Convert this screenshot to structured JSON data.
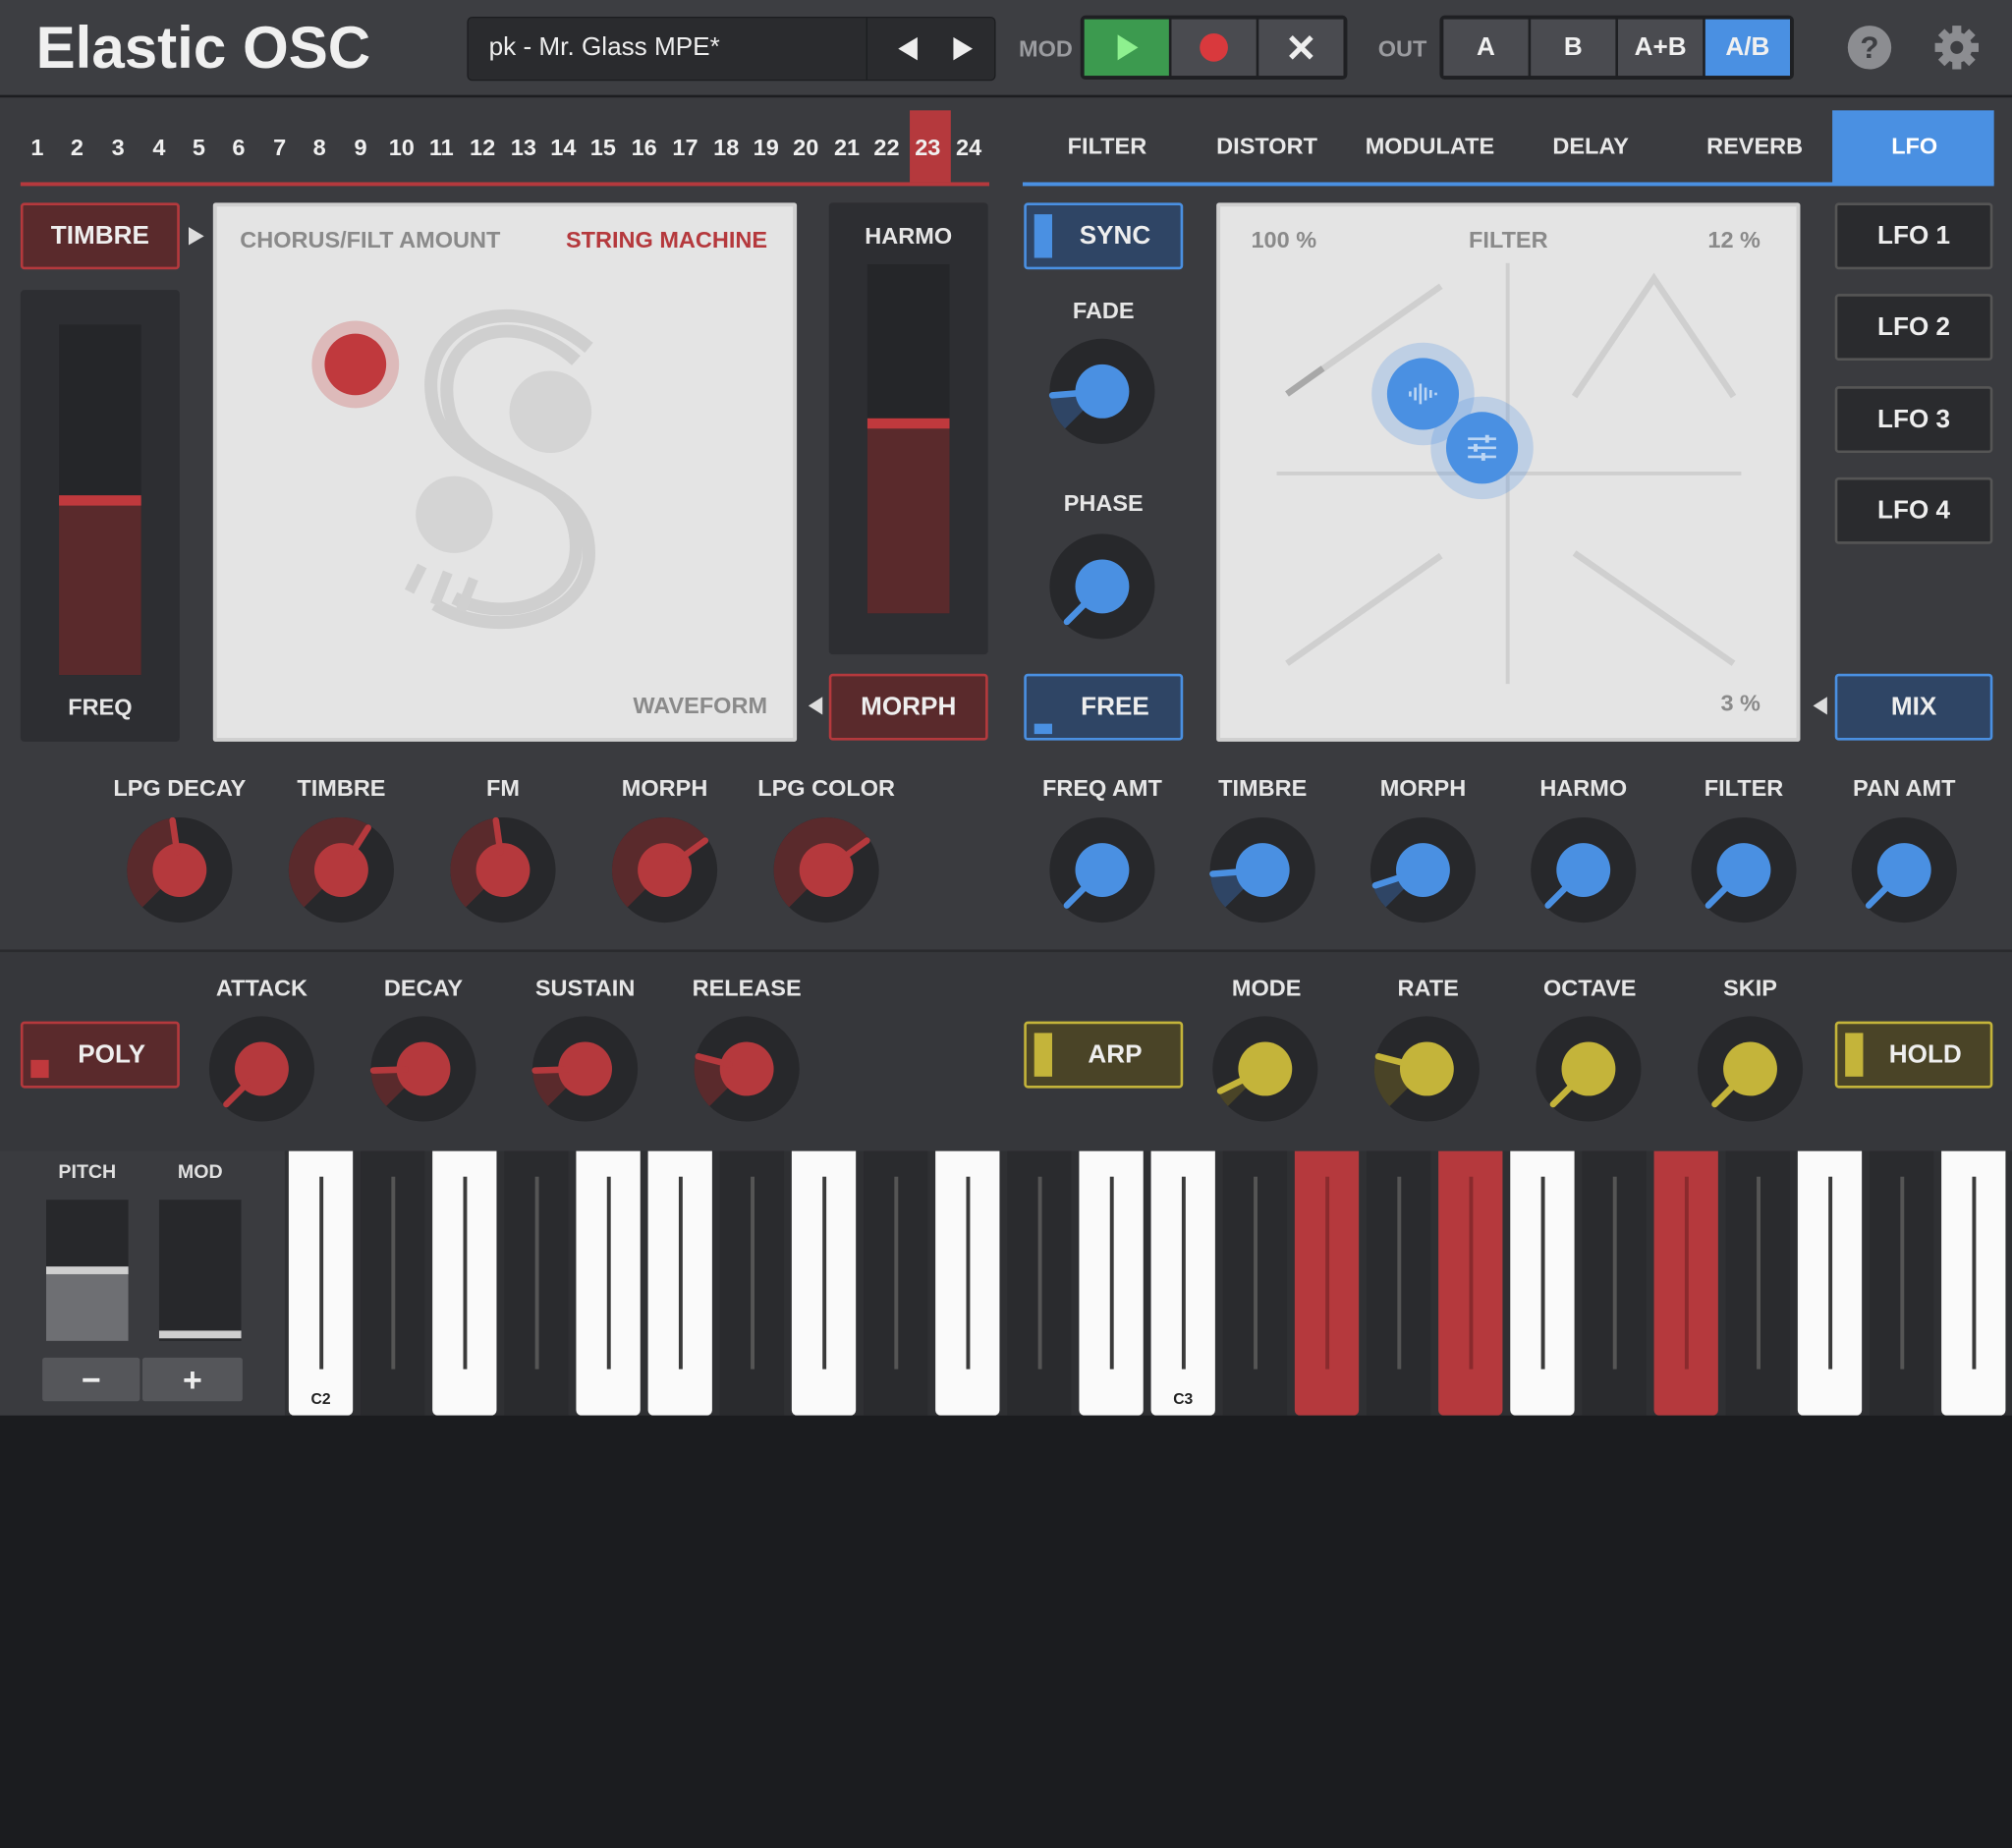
{
  "app": {
    "title": "Elastic OSC"
  },
  "preset": {
    "name": "pk - Mr. Glass MPE*"
  },
  "mod": {
    "label": "MOD"
  },
  "out": {
    "label": "OUT",
    "buttons": [
      "A",
      "B",
      "A+B",
      "A/B"
    ]
  },
  "channels": [
    "1",
    "2",
    "3",
    "4",
    "5",
    "6",
    "7",
    "8",
    "9",
    "10",
    "11",
    "12",
    "13",
    "14",
    "15",
    "16",
    "17",
    "18",
    "19",
    "20",
    "21",
    "22",
    "23",
    "24"
  ],
  "tabs": [
    "FILTER",
    "DISTORT",
    "MODULATE",
    "DELAY",
    "REVERB",
    "LFO"
  ],
  "osc": {
    "timbre_button": "TIMBRE",
    "freq_label": "FREQ",
    "xy_top_left": "CHORUS/FILT AMOUNT",
    "xy_top_right": "STRING MACHINE",
    "xy_bottom_right": "WAVEFORM",
    "harmo_label": "HARMO",
    "morph_button": "MORPH"
  },
  "osc_knobs": [
    "LPG DECAY",
    "TIMBRE",
    "FM",
    "MORPH",
    "LPG COLOR"
  ],
  "lfo": {
    "sync": "SYNC",
    "fade": "FADE",
    "phase": "PHASE",
    "free": "FREE",
    "xy_top_left": "100 %",
    "xy_top_center": "FILTER",
    "xy_top_right": "12 %",
    "xy_bottom_right": "3 %",
    "buttons": [
      "LFO 1",
      "LFO 2",
      "LFO 3",
      "LFO 4"
    ],
    "mix": "MIX"
  },
  "mod_knobs": [
    "FREQ AMT",
    "TIMBRE",
    "MORPH",
    "HARMO",
    "FILTER",
    "PAN AMT"
  ],
  "env": {
    "poly": "POLY",
    "knobs": [
      "ATTACK",
      "DECAY",
      "SUSTAIN",
      "RELEASE"
    ]
  },
  "arp": {
    "arp": "ARP",
    "knobs": [
      "MODE",
      "RATE",
      "OCTAVE",
      "SKIP"
    ],
    "hold": "HOLD"
  },
  "keyboard": {
    "pitch": "PITCH",
    "mod": "MOD",
    "minus": "−",
    "plus": "+",
    "c2": "C2",
    "c3": "C3"
  },
  "colors": {
    "red": "#b5393d",
    "blue": "#4a90e2",
    "yellow": "#c4b43a"
  }
}
